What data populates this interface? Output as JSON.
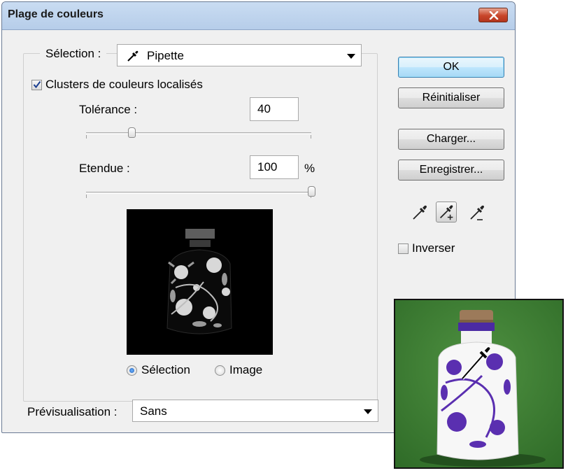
{
  "window": {
    "title": "Plage de couleurs"
  },
  "selection": {
    "label": "Sélection :",
    "value": "Pipette"
  },
  "clusters": {
    "label": "Clusters de couleurs localisés",
    "checked": true
  },
  "tolerance": {
    "label": "Tolérance :",
    "value": "40",
    "slider_fraction": 0.2
  },
  "range": {
    "label": "Etendue :",
    "value": "100",
    "unit": "%",
    "slider_fraction": 1.0
  },
  "view_mode": {
    "option1": "Sélection",
    "option2": "Image",
    "selected": "Sélection"
  },
  "buttons": {
    "ok": "OK",
    "reset": "Réinitialiser",
    "load": "Charger...",
    "save": "Enregistrer..."
  },
  "eyedroppers": [
    "eyedropper-icon",
    "eyedropper-add-icon",
    "eyedropper-subtract-icon"
  ],
  "invert": {
    "label": "Inverser",
    "checked": false
  },
  "preview": {
    "label": "Prévisualisation :",
    "value": "Sans"
  },
  "colors": {
    "dialog_bg": "#f0f0f0",
    "title_bar": "#c2d7ef",
    "close_button": "#c8452a",
    "default_button": "#bee6fd",
    "photo_bg": "#3d7d33",
    "vase_pattern": "#5a2fb0"
  }
}
